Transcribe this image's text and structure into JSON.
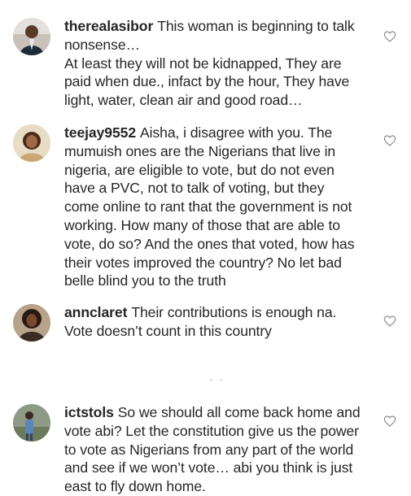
{
  "comments": [
    {
      "username": "therealasibor",
      "lines": [
        "This woman is beginning to talk",
        "nonsense…",
        "At least they will not be kidnapped, They are",
        "paid when due., infact by the hour, They have",
        "light, water, clean air and good road…"
      ],
      "avatar_icon": "avatar-photo",
      "like_icon": "heart-outline-icon"
    },
    {
      "username": "teejay9552",
      "lines": [
        "Aisha, i disagree with you.  The",
        "mumuish ones are the Nigerians that live in",
        "nigeria, are eligible to vote, but do not even",
        "have a PVC, not to talk of voting, but they",
        "come online to rant that the government is not",
        "working. How many of those that are able to",
        "vote, do so? And the ones that voted, how has",
        "their votes improved the country? No let bad",
        "belle blind you to the truth"
      ],
      "avatar_icon": "avatar-photo",
      "like_icon": "heart-outline-icon"
    },
    {
      "username": "annclaret",
      "lines": [
        "Their contributions is enough na.",
        "Vote doesn’t count in this country"
      ],
      "avatar_icon": "avatar-photo",
      "like_icon": "heart-outline-icon"
    },
    {
      "username": "ictstols",
      "lines": [
        "So we should all come back home and",
        "vote abi? Let the constitution give us the power",
        "to vote as Nigerians from any part of the world",
        "and see if we won’t vote… abi you think is just",
        "east to fly down home."
      ],
      "avatar_icon": "avatar-photo",
      "like_icon": "heart-outline-icon"
    }
  ],
  "separator": "· ·",
  "colors": {
    "text": "#262626",
    "heart": "#8e8e8e",
    "background": "#ffffff"
  }
}
